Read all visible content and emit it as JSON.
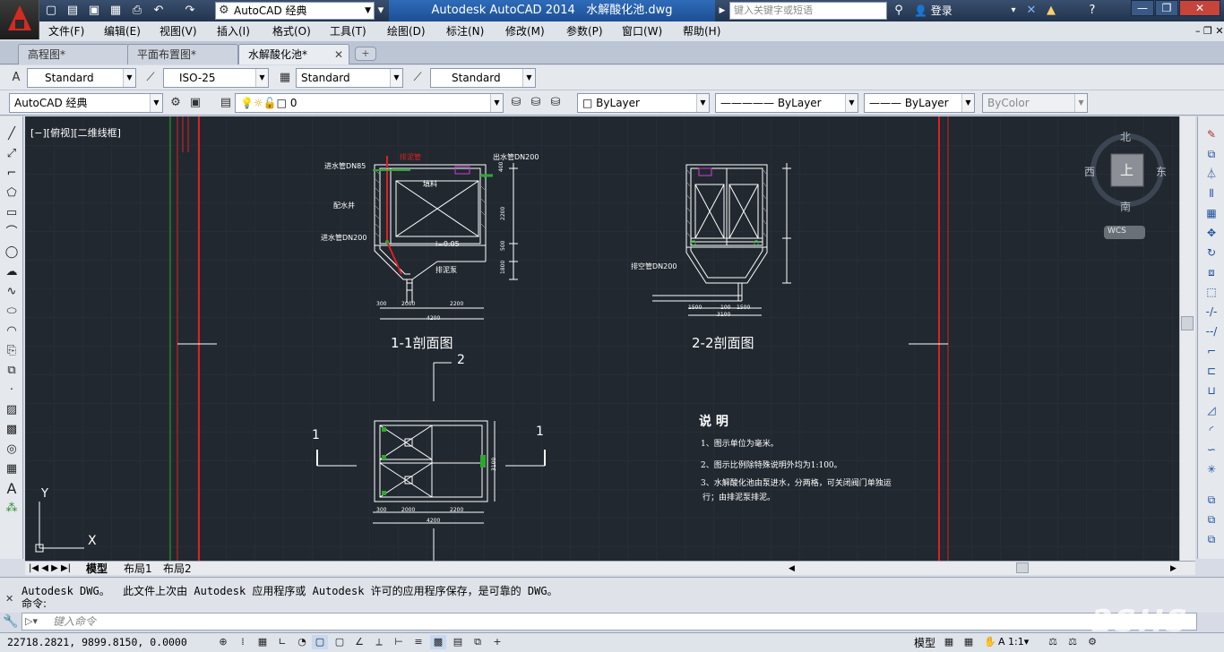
{
  "app": {
    "title": "Autodesk AutoCAD 2014",
    "filename": "水解酸化池.dwg",
    "workspace": "AutoCAD 经典",
    "search_placeholder": "键入关键字或短语",
    "login": "登录"
  },
  "menu": [
    "文件(F)",
    "编辑(E)",
    "视图(V)",
    "插入(I)",
    "格式(O)",
    "工具(T)",
    "绘图(D)",
    "标注(N)",
    "修改(M)",
    "参数(P)",
    "窗口(W)",
    "帮助(H)"
  ],
  "doc_tabs": [
    {
      "label": "高程图*",
      "active": false
    },
    {
      "label": "平面布置图*",
      "active": false
    },
    {
      "label": "水解酸化池*",
      "active": true
    }
  ],
  "styles_toolbar": {
    "text_style": "Standard",
    "dim_style": "ISO-25",
    "table_style": "Standard",
    "mleader_style": "Standard"
  },
  "layers_toolbar": {
    "workspace": "AutoCAD 经典",
    "layer": "0",
    "color": "ByLayer",
    "linetype": "ByLayer",
    "lineweight": "ByLayer",
    "plotstyle": "ByColor"
  },
  "viewport_label": "[−][俯视][二维线框]",
  "viewcube": {
    "north": "北",
    "south": "南",
    "east": "东",
    "west": "西",
    "top": "上",
    "wcs": "WCS"
  },
  "drawing": {
    "section1_title": "1-1剖面图",
    "section2_title": "2-2剖面图",
    "plan_marker_2": "2",
    "plan_marker_1_left": "1",
    "plan_marker_1_right": "1",
    "labels_sec1": [
      "进水管DN85",
      "排泥管",
      "出水管DN200",
      "填料",
      "配水井",
      "进水管DN200",
      "i=0.05",
      "排泥泵"
    ],
    "dims_sec1_bottom": [
      "300",
      "2000",
      "2200",
      "4200"
    ],
    "dims_sec1_side": [
      "400",
      "2200",
      "500",
      "1800"
    ],
    "labels_sec2": [
      "排空管DN200"
    ],
    "dims_sec2_bottom": [
      "1500",
      "100",
      "1500",
      "3100"
    ],
    "dims_plan_bottom": [
      "300",
      "2000",
      "2200",
      "4200"
    ],
    "dims_plan_side": [
      "3100"
    ],
    "notes_title": "说  明",
    "notes": [
      "1、图示单位为毫米。",
      "2、图示比例除特殊说明外均为1:100。",
      "3、水解酸化池由泵进水，分两格，可关闭阀门单独运",
      "行；由排泥泵排泥。"
    ],
    "ucs_x": "X",
    "ucs_y": "Y"
  },
  "layout_tabs": [
    "模型",
    "布局1",
    "布局2"
  ],
  "command": {
    "history": "Autodesk DWG。  此文件上次由 Autodesk 应用程序或 Autodesk 许可的应用程序保存，是可靠的 DWG。",
    "prompt": "命令:",
    "input_placeholder": "键入命令"
  },
  "status": {
    "coords": "22718.2821, 9899.8150, 0.0000",
    "model": "模型",
    "scale": "1:1"
  },
  "watermark": "2SHS"
}
